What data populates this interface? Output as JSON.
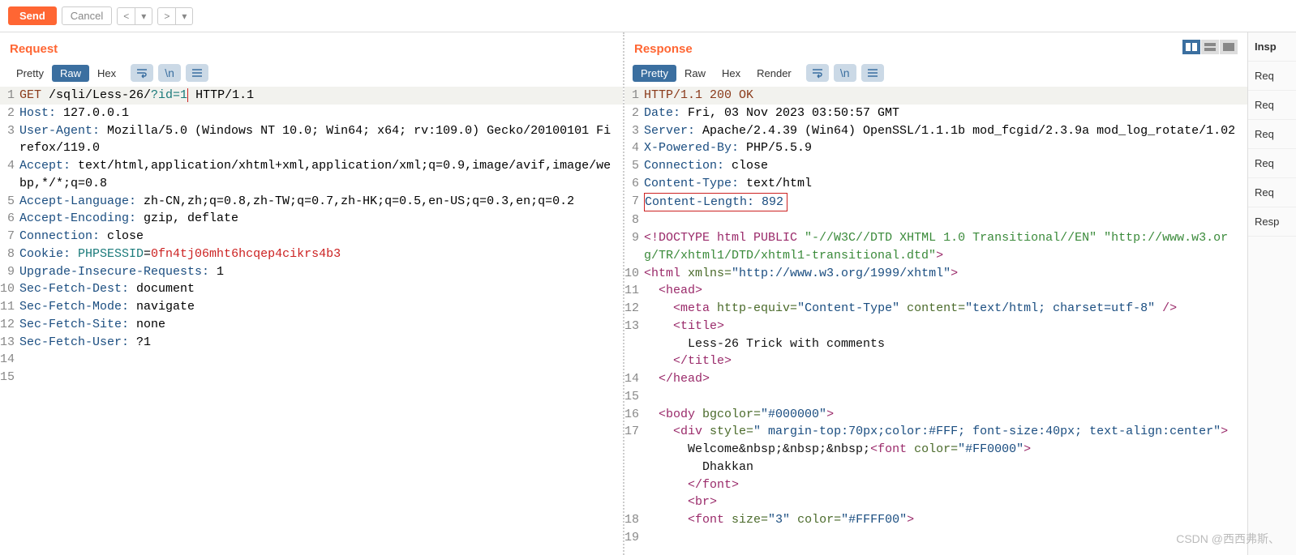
{
  "toolbar": {
    "send": "Send",
    "cancel": "Cancel"
  },
  "request": {
    "title": "Request",
    "tabs": {
      "pretty": "Pretty",
      "raw": "Raw",
      "hex": "Hex"
    },
    "lines": {
      "l1_method": "GET",
      "l1_path": " /sqli/Less-26/",
      "l1_param": "?id=1",
      "l1_proto": " HTTP/1.1",
      "l2_k": "Host:",
      "l2_v": " 127.0.0.1",
      "l3_k": "User-Agent:",
      "l3_v": " Mozilla/5.0 (Windows NT 10.0; Win64; x64; rv:109.0) Gecko/20100101 Firefox/119.0",
      "l4_k": "Accept:",
      "l4_v": " text/html,application/xhtml+xml,application/xml;q=0.9,image/avif,image/webp,*/*;q=0.8",
      "l5_k": "Accept-Language:",
      "l5_v": " zh-CN,zh;q=0.8,zh-TW;q=0.7,zh-HK;q=0.5,en-US;q=0.3,en;q=0.2",
      "l6_k": "Accept-Encoding:",
      "l6_v": " gzip, deflate",
      "l7_k": "Connection:",
      "l7_v": " close",
      "l8_k": "Cookie:",
      "l8_ck": " PHPSESSID",
      "l8_eq": "=",
      "l8_cv": "0fn4tj06mht6hcqep4cikrs4b3",
      "l9_k": "Upgrade-Insecure-Requests:",
      "l9_v": " 1",
      "l10_k": "Sec-Fetch-Dest:",
      "l10_v": " document",
      "l11_k": "Sec-Fetch-Mode:",
      "l11_v": " navigate",
      "l12_k": "Sec-Fetch-Site:",
      "l12_v": " none",
      "l13_k": "Sec-Fetch-User:",
      "l13_v": " ?1"
    }
  },
  "response": {
    "title": "Response",
    "tabs": {
      "pretty": "Pretty",
      "raw": "Raw",
      "hex": "Hex",
      "render": "Render"
    },
    "headers": {
      "l1": "HTTP/1.1 200 OK",
      "l2_k": "Date:",
      "l2_v": " Fri, 03 Nov 2023 03:50:57 GMT",
      "l3_k": "Server:",
      "l3_v": " Apache/2.4.39 (Win64) OpenSSL/1.1.1b mod_fcgid/2.3.9a mod_log_rotate/1.02",
      "l4_k": "X-Powered-By:",
      "l4_v": " PHP/5.5.9",
      "l5_k": "Connection:",
      "l5_v": " close",
      "l6_k": "Content-Type:",
      "l6_v": " text/html",
      "l7_full": "Content-Length: 892"
    },
    "body": {
      "l9_a": "<!DOCTYPE html PUBLIC ",
      "l9_b": "\"-//W3C//DTD XHTML 1.0 Transitional//EN\"",
      "l9_c": " \"http://www.w3.org/TR/xhtml1/DTD/xhtml1-transitional.dtd\"",
      "l9_d": ">",
      "l10_a": "<html ",
      "l10_attr": "xmlns=",
      "l10_val": "\"http://www.w3.org/1999/xhtml\"",
      "l10_b": ">",
      "l11": "  <head>",
      "l12_a": "    <meta ",
      "l12_attr1": "http-equiv=",
      "l12_v1": "\"Content-Type\"",
      "l12_attr2": " content=",
      "l12_v2": "\"text/html; charset=utf-8\"",
      "l12_b": " />",
      "l13": "    <title>",
      "l13b": "      Less-26 Trick with comments",
      "l13c": "    </title>",
      "l14": "  </head>",
      "l16_a": "  <body ",
      "l16_attr": "bgcolor=",
      "l16_v": "\"#000000\"",
      "l16_b": ">",
      "l17_a": "    <div ",
      "l17_attr": "style=",
      "l17_v": "\" margin-top:70px;color:#FFF; font-size:40px; text-align:center\"",
      "l17_b": ">",
      "l17c_a": "      Welcome&nbsp;&nbsp;&nbsp;",
      "l17c_b": "<font ",
      "l17c_attr": "color=",
      "l17c_v": "\"#FF0000\"",
      "l17c_c": ">",
      "l17d": "        Dhakkan",
      "l17e": "      </font>",
      "l17f": "      <br>",
      "l18_a": "      <font ",
      "l18_attr1": "size=",
      "l18_v1": "\"3\"",
      "l18_attr2": " color=",
      "l18_v2": "\"#FFFF00\"",
      "l18_b": ">"
    }
  },
  "sidebar": {
    "items": [
      "Insp",
      "Req",
      "Req",
      "Req",
      "Req",
      "Req",
      "Resp"
    ]
  },
  "watermark": "CSDN @西西弗斯、"
}
